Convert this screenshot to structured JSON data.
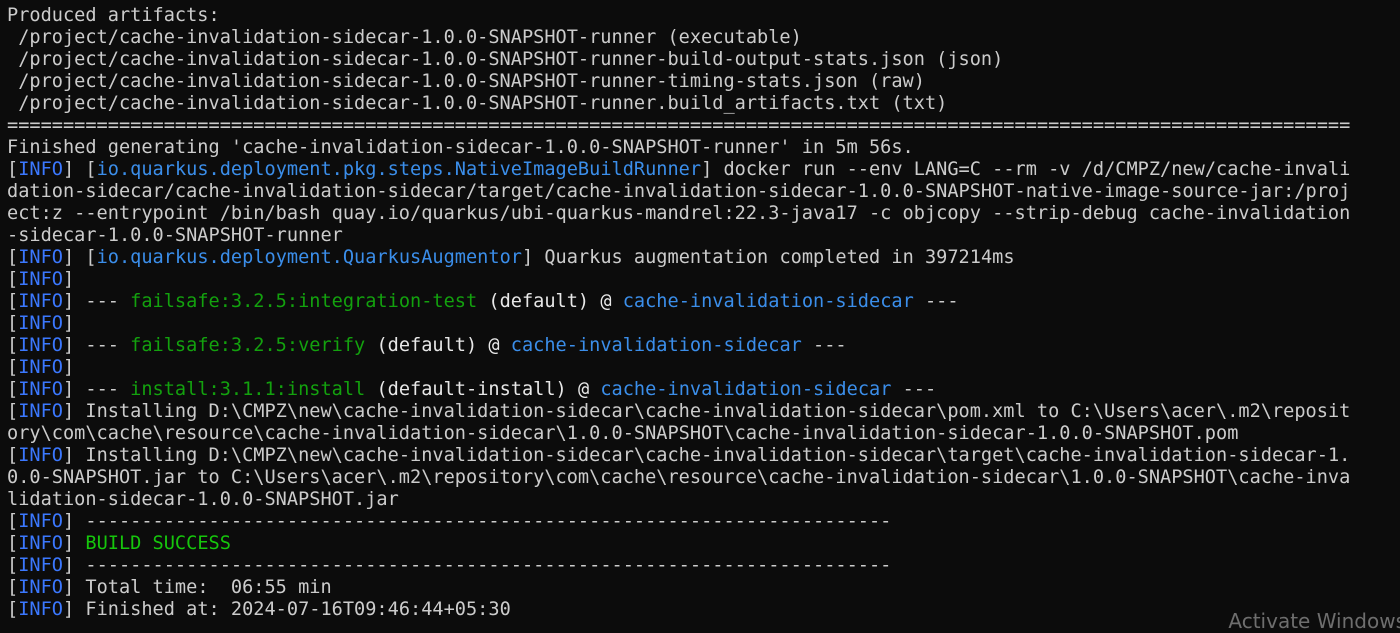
{
  "window": {
    "app": "Windows Terminal",
    "watermark": "Activate Windows"
  },
  "colors": {
    "background": "#0c0c0c",
    "text": "#cccccc",
    "info_tag": "#3b78ff",
    "module": "#3b8eea",
    "plugin": "#13a10e",
    "success": "#16c60c"
  },
  "lines": [
    [
      {
        "t": "Produced artifacts:"
      }
    ],
    [
      {
        "t": " /project/cache-invalidation-sidecar-1.0.0-SNAPSHOT-runner (executable)"
      }
    ],
    [
      {
        "t": " /project/cache-invalidation-sidecar-1.0.0-SNAPSHOT-runner-build-output-stats.json (json)"
      }
    ],
    [
      {
        "t": " /project/cache-invalidation-sidecar-1.0.0-SNAPSHOT-runner-timing-stats.json (raw)"
      }
    ],
    [
      {
        "t": " /project/cache-invalidation-sidecar-1.0.0-SNAPSHOT-runner.build_artifacts.txt (txt)"
      }
    ],
    [
      {
        "t": "========================================================================================================================"
      }
    ],
    [
      {
        "t": "Finished generating 'cache-invalidation-sidecar-1.0.0-SNAPSHOT-runner' in 5m 56s."
      }
    ],
    [
      {
        "t": "["
      },
      {
        "t": "INFO",
        "c": "info"
      },
      {
        "t": "] ["
      },
      {
        "t": "io.quarkus.deployment.pkg.steps.NativeImageBuildRunner",
        "c": "blue"
      },
      {
        "t": "] docker run --env LANG=C --rm -v /d/CMPZ/new/cache-invali"
      }
    ],
    [
      {
        "t": "dation-sidecar/cache-invalidation-sidecar/target/cache-invalidation-sidecar-1.0.0-SNAPSHOT-native-image-source-jar:/proj"
      }
    ],
    [
      {
        "t": "ect:z --entrypoint /bin/bash quay.io/quarkus/ubi-quarkus-mandrel:22.3-java17 -c objcopy --strip-debug cache-invalidation"
      }
    ],
    [
      {
        "t": "-sidecar-1.0.0-SNAPSHOT-runner"
      }
    ],
    [
      {
        "t": "["
      },
      {
        "t": "INFO",
        "c": "info"
      },
      {
        "t": "] ["
      },
      {
        "t": "io.quarkus.deployment.QuarkusAugmentor",
        "c": "blue"
      },
      {
        "t": "] Quarkus augmentation completed in 397214ms"
      }
    ],
    [
      {
        "t": "["
      },
      {
        "t": "INFO",
        "c": "info"
      },
      {
        "t": "]"
      }
    ],
    [
      {
        "t": "["
      },
      {
        "t": "INFO",
        "c": "info"
      },
      {
        "t": "] --- "
      },
      {
        "t": "failsafe:3.2.5:integration-test",
        "c": "green"
      },
      {
        "t": " (default) @ ",
        "c": "white"
      },
      {
        "t": "cache-invalidation-sidecar",
        "c": "blue"
      },
      {
        "t": " ---"
      }
    ],
    [
      {
        "t": "["
      },
      {
        "t": "INFO",
        "c": "info"
      },
      {
        "t": "]"
      }
    ],
    [
      {
        "t": "["
      },
      {
        "t": "INFO",
        "c": "info"
      },
      {
        "t": "] --- "
      },
      {
        "t": "failsafe:3.2.5:verify",
        "c": "green"
      },
      {
        "t": " (default) @ ",
        "c": "white"
      },
      {
        "t": "cache-invalidation-sidecar",
        "c": "blue"
      },
      {
        "t": " ---"
      }
    ],
    [
      {
        "t": "["
      },
      {
        "t": "INFO",
        "c": "info"
      },
      {
        "t": "]"
      }
    ],
    [
      {
        "t": "["
      },
      {
        "t": "INFO",
        "c": "info"
      },
      {
        "t": "] --- "
      },
      {
        "t": "install:3.1.1:install",
        "c": "green"
      },
      {
        "t": " (default-install) @ ",
        "c": "white"
      },
      {
        "t": "cache-invalidation-sidecar",
        "c": "blue"
      },
      {
        "t": " ---"
      }
    ],
    [
      {
        "t": "["
      },
      {
        "t": "INFO",
        "c": "info"
      },
      {
        "t": "] Installing D:\\CMPZ\\new\\cache-invalidation-sidecar\\cache-invalidation-sidecar\\pom.xml to C:\\Users\\acer\\.m2\\reposit"
      }
    ],
    [
      {
        "t": "ory\\com\\cache\\resource\\cache-invalidation-sidecar\\1.0.0-SNAPSHOT\\cache-invalidation-sidecar-1.0.0-SNAPSHOT.pom"
      }
    ],
    [
      {
        "t": "["
      },
      {
        "t": "INFO",
        "c": "info"
      },
      {
        "t": "] Installing D:\\CMPZ\\new\\cache-invalidation-sidecar\\cache-invalidation-sidecar\\target\\cache-invalidation-sidecar-1."
      }
    ],
    [
      {
        "t": "0.0-SNAPSHOT.jar to C:\\Users\\acer\\.m2\\repository\\com\\cache\\resource\\cache-invalidation-sidecar\\1.0.0-SNAPSHOT\\cache-inva"
      }
    ],
    [
      {
        "t": "lidation-sidecar-1.0.0-SNAPSHOT.jar"
      }
    ],
    [
      {
        "t": "["
      },
      {
        "t": "INFO",
        "c": "info"
      },
      {
        "t": "] ------------------------------------------------------------------------"
      }
    ],
    [
      {
        "t": "["
      },
      {
        "t": "INFO",
        "c": "info"
      },
      {
        "t": "] "
      },
      {
        "t": "BUILD SUCCESS",
        "c": "bright-green"
      }
    ],
    [
      {
        "t": "["
      },
      {
        "t": "INFO",
        "c": "info"
      },
      {
        "t": "] ------------------------------------------------------------------------"
      }
    ],
    [
      {
        "t": "["
      },
      {
        "t": "INFO",
        "c": "info"
      },
      {
        "t": "] Total time:  06:55 min"
      }
    ],
    [
      {
        "t": "["
      },
      {
        "t": "INFO",
        "c": "info"
      },
      {
        "t": "] Finished at: 2024-07-16T09:46:44+05:30"
      }
    ]
  ]
}
